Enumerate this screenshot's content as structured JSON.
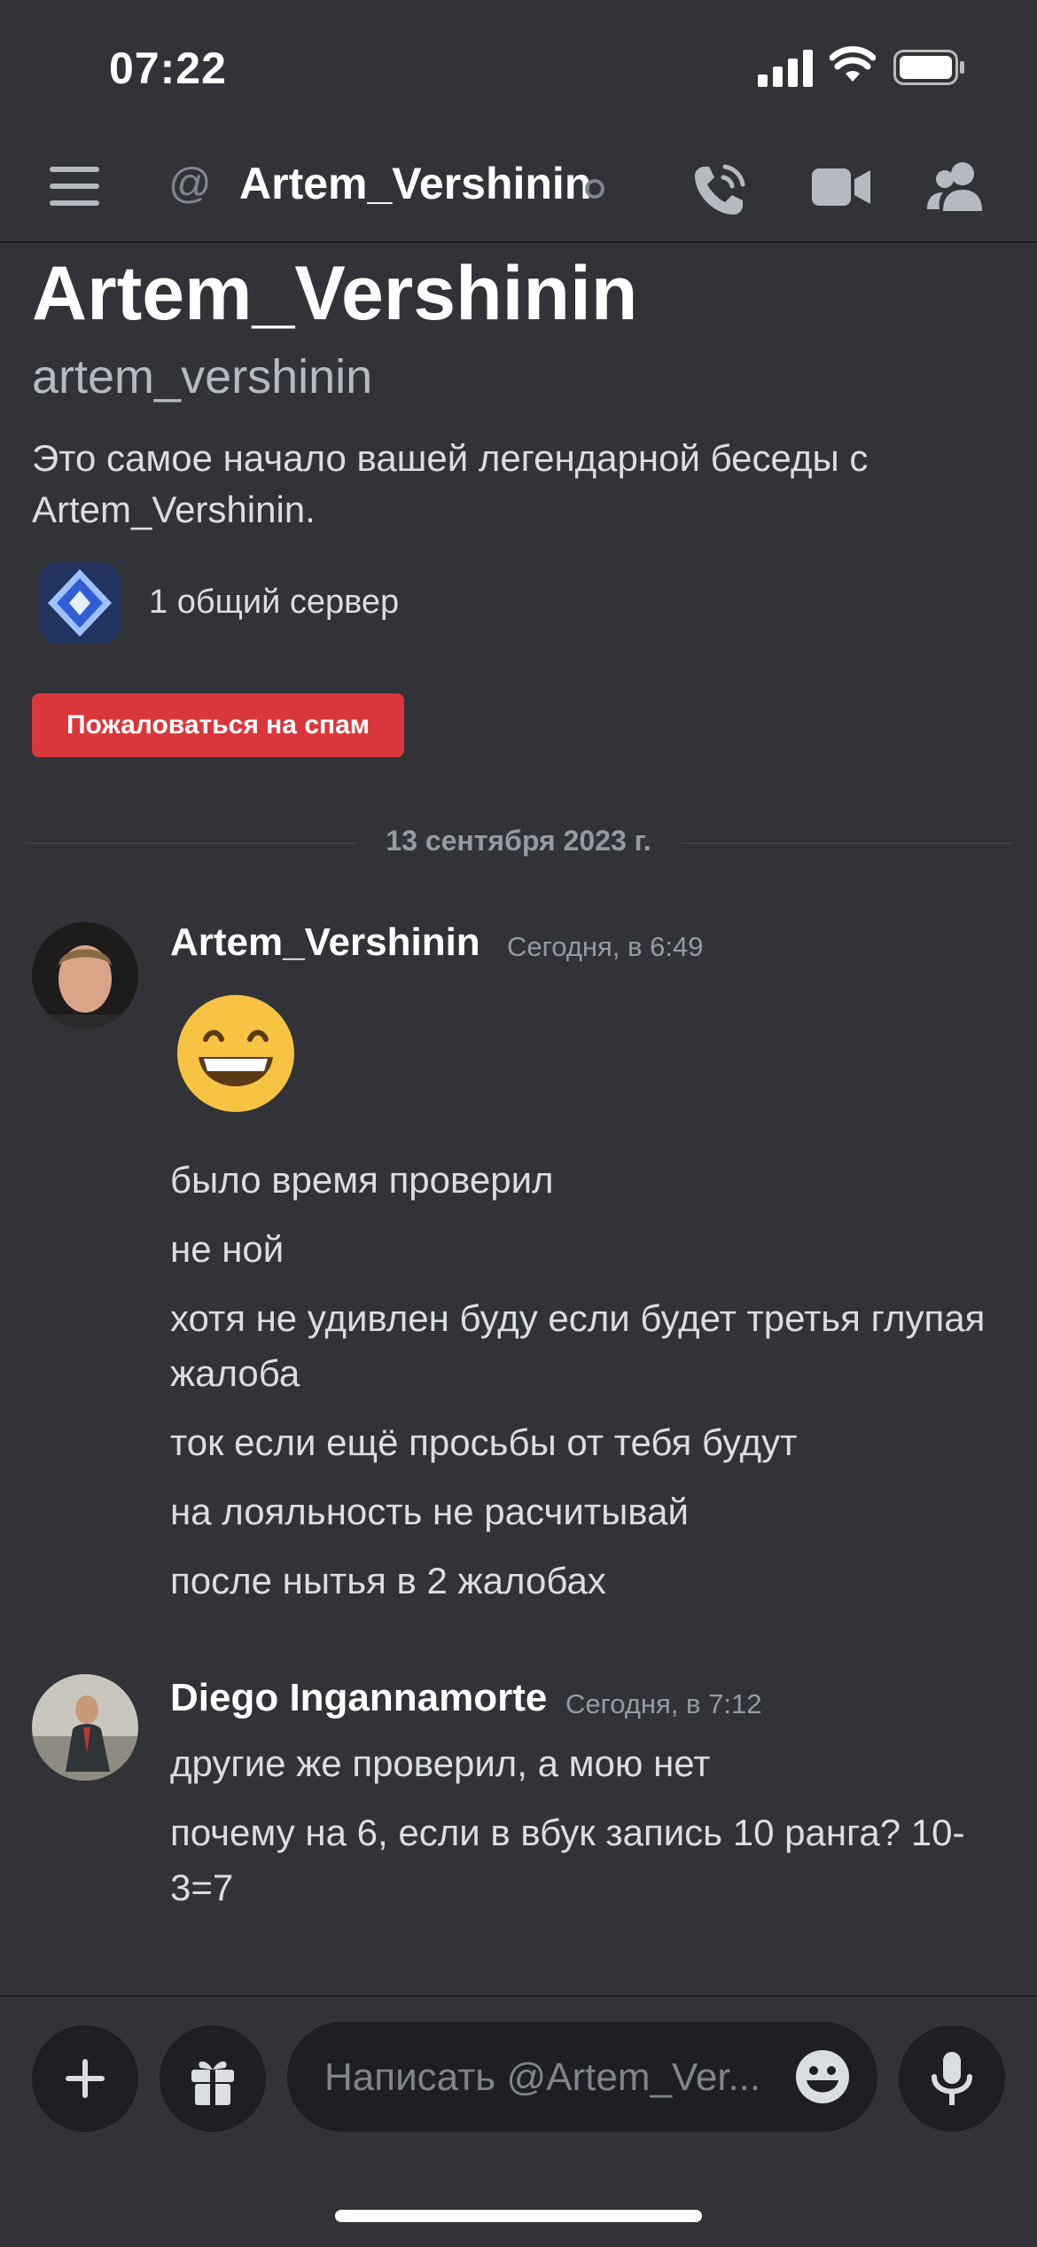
{
  "status_bar": {
    "time": "07:22"
  },
  "header": {
    "title": "Artem_Vershinin",
    "at_symbol": "@"
  },
  "intro": {
    "display_name": "Artem_Vershinin",
    "username": "artem_vershinin",
    "description": "Это самое начало вашей легендарной беседы с Artem_Vershinin.",
    "mutual_servers": "1 общий сервер",
    "spam_button": "Пожаловаться на спам"
  },
  "divider": {
    "date": "13 сентября 2023 г."
  },
  "messages": [
    {
      "author": "Artem_Vershinin",
      "time": "Сегодня, в 6:49",
      "lines": [
        "было время проверил",
        "не ной",
        "хотя не удивлен буду если будет третья глупая жалоба",
        "ток если ещё просьбы от тебя будут",
        "на лояльность не расчитывай",
        "после нытья в 2 жалобах"
      ]
    },
    {
      "author": "Diego Ingannamorte",
      "time": "Сегодня, в 7:12",
      "lines": [
        "другие же проверил, а мою нет",
        "почему на 6, если в вбук запись 10 ранга? 10-3=7"
      ]
    }
  ],
  "composer": {
    "placeholder": "Написать @Artem_Ver..."
  },
  "colors": {
    "background": "#313338",
    "accent_red": "#da373c",
    "muted": "#949ba4"
  }
}
